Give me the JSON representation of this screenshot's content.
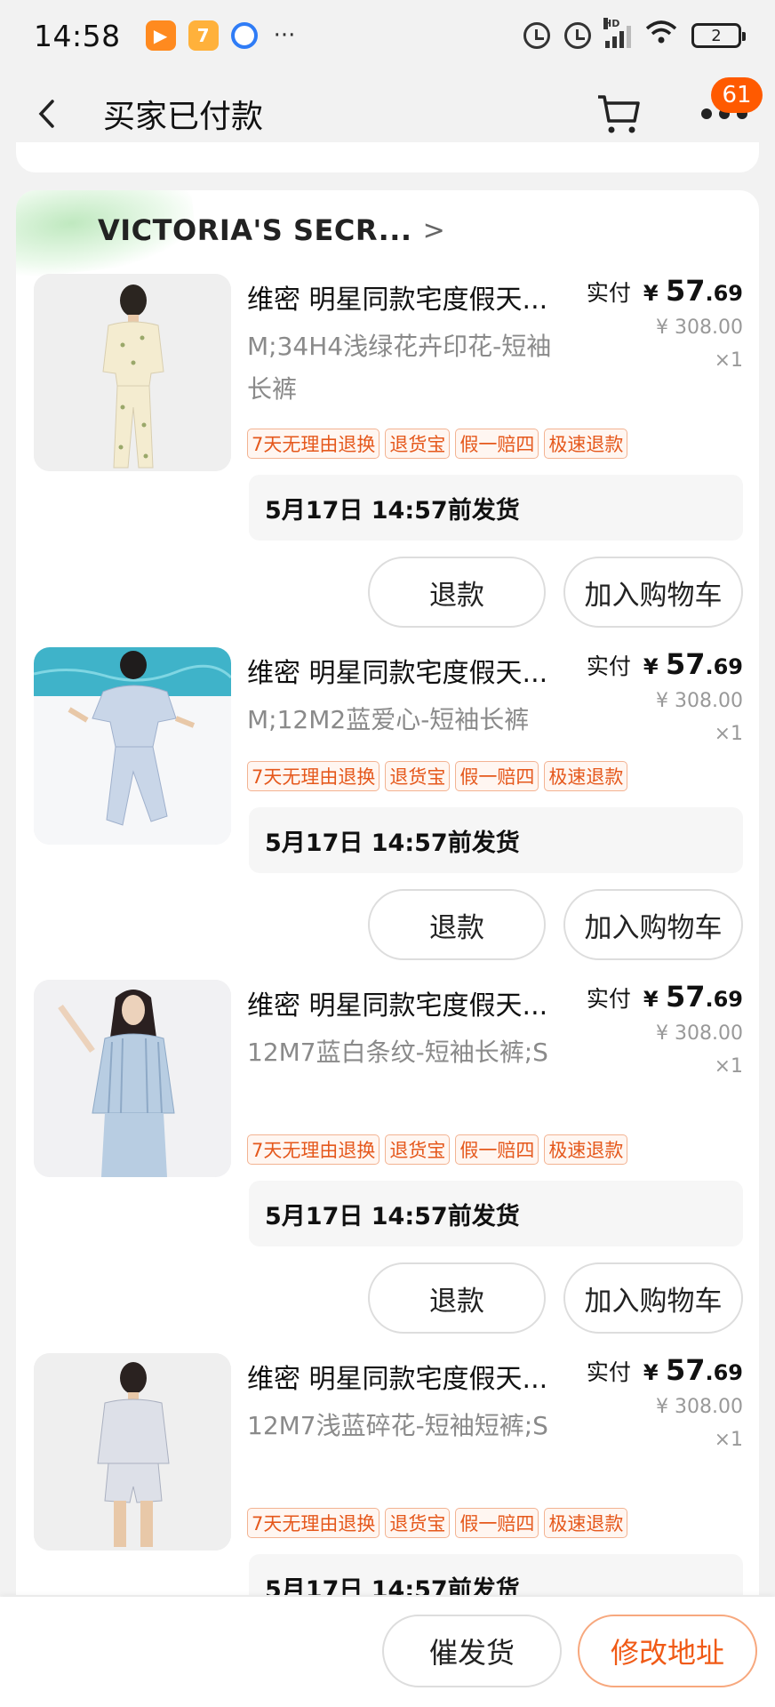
{
  "status_bar": {
    "time": "14:58",
    "overflow": "···",
    "signal_label": "HD",
    "battery": "2"
  },
  "header": {
    "title": "买家已付款",
    "message_badge": "61"
  },
  "shop": {
    "name": "VICTORIA'S SECR...",
    "chevron": ">"
  },
  "labels": {
    "paid": "实付",
    "refund": "退款",
    "add_cart": "加入购物车"
  },
  "items": [
    {
      "title": "维密 明星同款宅度假天...",
      "sku": "M;34H4浅绿花卉印花-短袖长裤",
      "price_currency": "¥",
      "price_int": "57",
      "price_dec": ".69",
      "orig_price": "¥ 308.00",
      "qty": "×1",
      "tags": [
        "7天无理由退换",
        "退货宝",
        "假一赔四",
        "极速退款"
      ],
      "ship": "5月17日 14:57前发货"
    },
    {
      "title": "维密 明星同款宅度假天...",
      "sku": "M;12M2蓝爱心-短袖长裤",
      "price_currency": "¥",
      "price_int": "57",
      "price_dec": ".69",
      "orig_price": "¥ 308.00",
      "qty": "×1",
      "tags": [
        "7天无理由退换",
        "退货宝",
        "假一赔四",
        "极速退款"
      ],
      "ship": "5月17日 14:57前发货"
    },
    {
      "title": "维密 明星同款宅度假天...",
      "sku": "12M7蓝白条纹-短袖长裤;S",
      "price_currency": "¥",
      "price_int": "57",
      "price_dec": ".69",
      "orig_price": "¥ 308.00",
      "qty": "×1",
      "tags": [
        "7天无理由退换",
        "退货宝",
        "假一赔四",
        "极速退款"
      ],
      "ship": "5月17日 14:57前发货"
    },
    {
      "title": "维密 明星同款宅度假天...",
      "sku": "12M7浅蓝碎花-短袖短裤;S",
      "price_currency": "¥",
      "price_int": "57",
      "price_dec": ".69",
      "orig_price": "¥ 308.00",
      "qty": "×1",
      "tags": [
        "7天无理由退换",
        "退货宝",
        "假一赔四",
        "极速退款"
      ],
      "ship": "5月17日 14:57前发货"
    }
  ],
  "bottom_bar": {
    "urge": "催发货",
    "change_address": "修改地址"
  },
  "colors": {
    "accent": "#f05a16",
    "badge": "#ff5a00",
    "tag_text": "#e5581c"
  }
}
